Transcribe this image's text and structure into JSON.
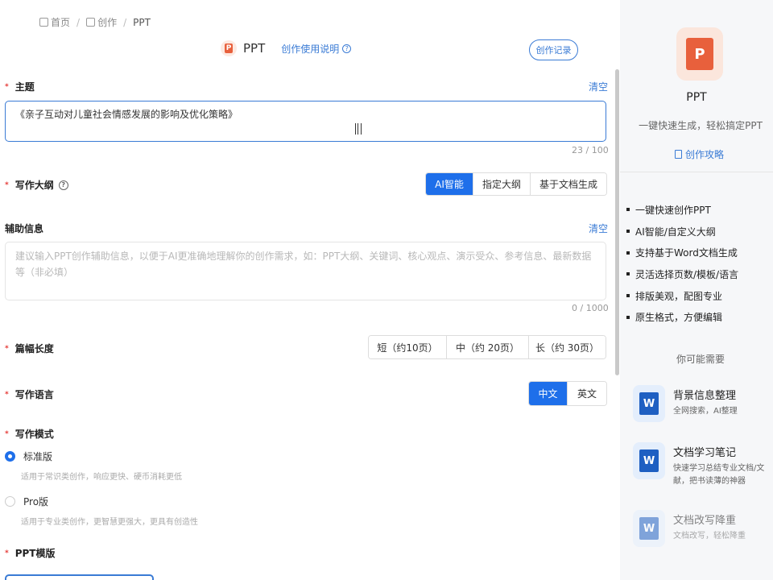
{
  "breadcrumb": {
    "home": "首页",
    "create": "创作",
    "current": "PPT",
    "sep": "/"
  },
  "header": {
    "title": "PPT",
    "help_link": "创作使用说明",
    "record_button": "创作记录"
  },
  "topic": {
    "label": "主题",
    "clear": "清空",
    "value": "《亲子互动对儿童社会情感发展的影响及优化策略》",
    "count": "23 / 100"
  },
  "outline": {
    "label": "写作大纲",
    "options": [
      "AI智能",
      "指定大纲",
      "基于文档生成"
    ],
    "selected": "AI智能"
  },
  "aux": {
    "label": "辅助信息",
    "clear": "清空",
    "placeholder": "建议输入PPT创作辅助信息，以便于AI更准确地理解你的创作需求，如：PPT大纲、关键词、核心观点、演示受众、参考信息、最新数据等（非必填）",
    "count": "0 / 1000"
  },
  "length": {
    "label": "篇幅长度",
    "options": [
      "短（约10页）",
      "中（约 20页）",
      "长（约 30页）"
    ]
  },
  "language": {
    "label": "写作语言",
    "options": [
      "中文",
      "英文"
    ],
    "selected": "中文"
  },
  "mode": {
    "label": "写作模式",
    "options": [
      {
        "name": "标准版",
        "desc": "适用于常识类创作，响应更快、硬币消耗更低",
        "selected": true
      },
      {
        "name": "Pro版",
        "desc": "适用于专业类创作，更智慧更强大，更具有创造性",
        "selected": false
      }
    ]
  },
  "template": {
    "label": "PPT模版"
  },
  "side": {
    "title": "PPT",
    "subtitle": "一键快速生成，轻松搞定PPT",
    "guide_link": "创作攻略",
    "features": [
      "一键快速创作PPT",
      "AI智能/自定义大纲",
      "支持基于Word文档生成",
      "灵活选择页数/模板/语言",
      "排版美观，配图专业",
      "原生格式，方便编辑"
    ],
    "maybe_title": "你可能需要",
    "recommendations": [
      {
        "title": "背景信息整理",
        "desc": "全网搜索，AI整理"
      },
      {
        "title": "文档学习笔记",
        "desc": "快速学习总结专业文档/文献，把书读薄的神器"
      },
      {
        "title": "文档改写降重",
        "desc": "文档改写，轻松降重"
      }
    ]
  },
  "colors": {
    "accent": "#1e6fea",
    "link": "#3a7bd5",
    "required": "#e53935",
    "ppt_brand": "#e8603c"
  }
}
